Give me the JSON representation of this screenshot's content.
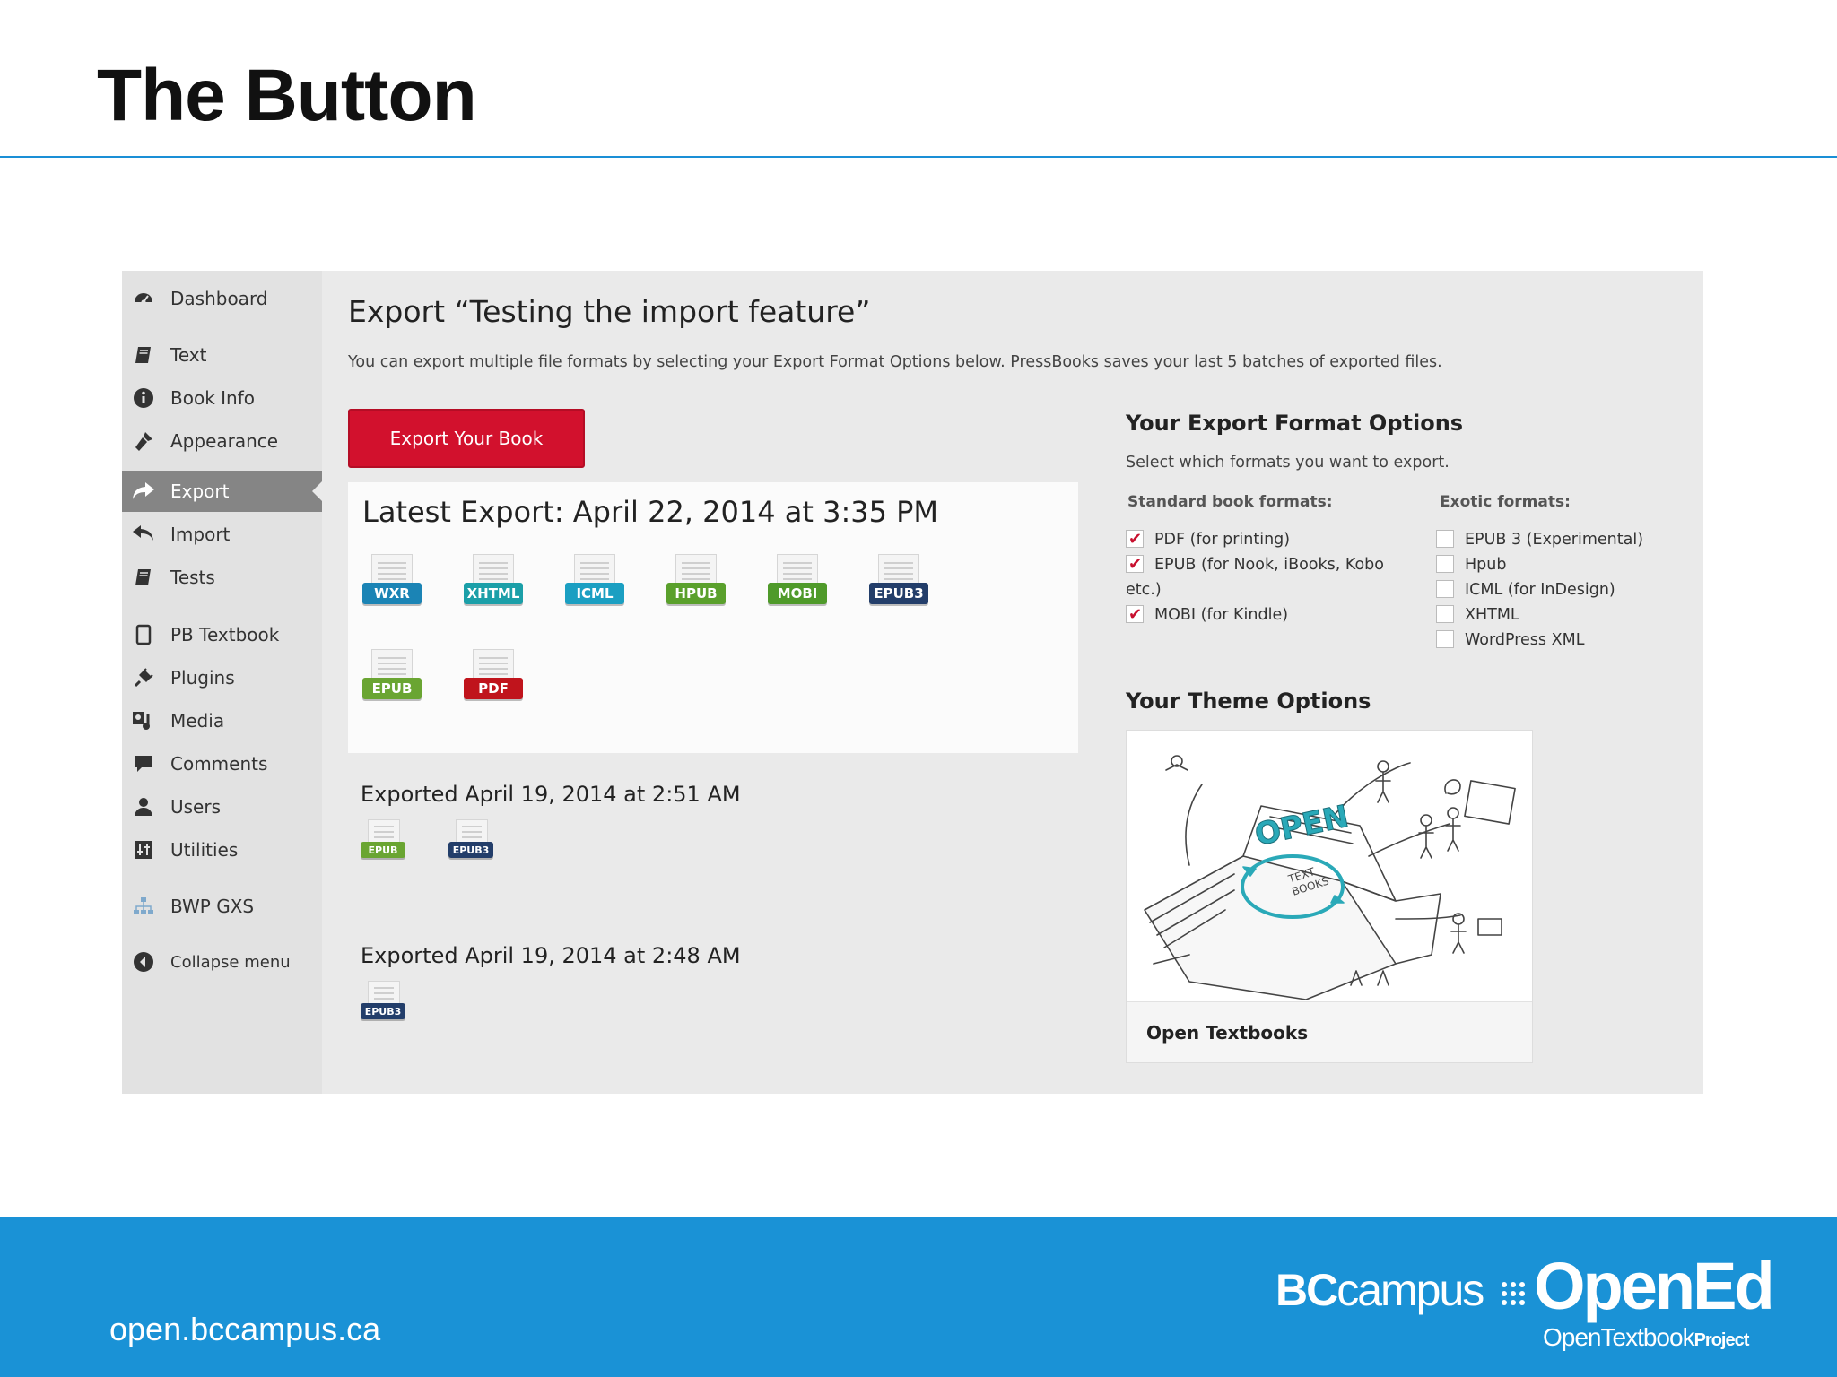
{
  "slide": {
    "title": "The Button",
    "footer_url": "open.bccampus.ca",
    "logo_bc": "BC",
    "logo_campus": "campus",
    "logo_opened": "OpenEd",
    "logo_sub": "OpenTextbook",
    "logo_sub_suffix": "Project",
    "accent_color": "#1a92d6"
  },
  "sidebar": {
    "items": [
      {
        "label": "Dashboard",
        "icon": "dashboard-icon"
      },
      {
        "label": "Text",
        "icon": "book-icon"
      },
      {
        "label": "Book Info",
        "icon": "info-icon"
      },
      {
        "label": "Appearance",
        "icon": "brush-icon"
      },
      {
        "label": "Export",
        "icon": "share-arrow-icon",
        "active": true
      },
      {
        "label": "Import",
        "icon": "reply-arrow-icon"
      },
      {
        "label": "Tests",
        "icon": "book-icon"
      },
      {
        "label": "PB Textbook",
        "icon": "page-icon"
      },
      {
        "label": "Plugins",
        "icon": "plug-icon"
      },
      {
        "label": "Media",
        "icon": "media-icon"
      },
      {
        "label": "Comments",
        "icon": "comment-icon"
      },
      {
        "label": "Users",
        "icon": "user-icon"
      },
      {
        "label": "Utilities",
        "icon": "tools-icon"
      },
      {
        "label": "BWP GXS",
        "icon": "sitemap-icon"
      },
      {
        "label": "Collapse menu",
        "icon": "collapse-icon"
      }
    ]
  },
  "main": {
    "heading": "Export “Testing the import feature”",
    "description": "You can export multiple file formats by selecting your Export Format Options below. PressBooks saves your last 5 batches of exported files.",
    "export_button": "Export Your Book",
    "latest": {
      "title": "Latest Export: April 22, 2014 at 3:35 PM",
      "files": [
        {
          "label": "WXR",
          "color": "#1b84b5"
        },
        {
          "label": "XHTML",
          "color": "#1b9fa8"
        },
        {
          "label": "ICML",
          "color": "#1b9fc2"
        },
        {
          "label": "HPUB",
          "color": "#5aa02c"
        },
        {
          "label": "MOBI",
          "color": "#4f9a2a"
        },
        {
          "label": "EPUB3",
          "color": "#233e6a"
        },
        {
          "label": "EPUB",
          "color": "#6aa532"
        },
        {
          "label": "PDF",
          "color": "#c0141c"
        }
      ]
    },
    "history": [
      {
        "title": "Exported April 19, 2014 at 2:51 AM",
        "files": [
          {
            "label": "EPUB",
            "color": "#6aa532"
          },
          {
            "label": "EPUB3",
            "color": "#233e6a"
          }
        ]
      },
      {
        "title": "Exported April 19, 2014 at 2:48 AM",
        "files": [
          {
            "label": "EPUB3",
            "color": "#233e6a"
          }
        ]
      }
    ]
  },
  "options": {
    "title": "Your Export Format Options",
    "description": "Select which formats you want to export.",
    "standard_heading": "Standard book formats:",
    "exotic_heading": "Exotic formats:",
    "standard": [
      {
        "label": "PDF (for printing)",
        "checked": true
      },
      {
        "label": "EPUB (for Nook, iBooks, Kobo",
        "continuation": "etc.)",
        "checked": true
      },
      {
        "label": "MOBI (for Kindle)",
        "checked": true
      }
    ],
    "exotic": [
      {
        "label": "EPUB 3 (Experimental)",
        "checked": false
      },
      {
        "label": "Hpub",
        "checked": false
      },
      {
        "label": "ICML (for InDesign)",
        "checked": false
      },
      {
        "label": "XHTML",
        "checked": false
      },
      {
        "label": "WordPress XML",
        "checked": false
      }
    ],
    "theme_title": "Your Theme Options",
    "theme_name": "Open Textbooks",
    "theme_art_text": [
      "OPEN",
      "TEXT",
      "BOOKS"
    ]
  }
}
